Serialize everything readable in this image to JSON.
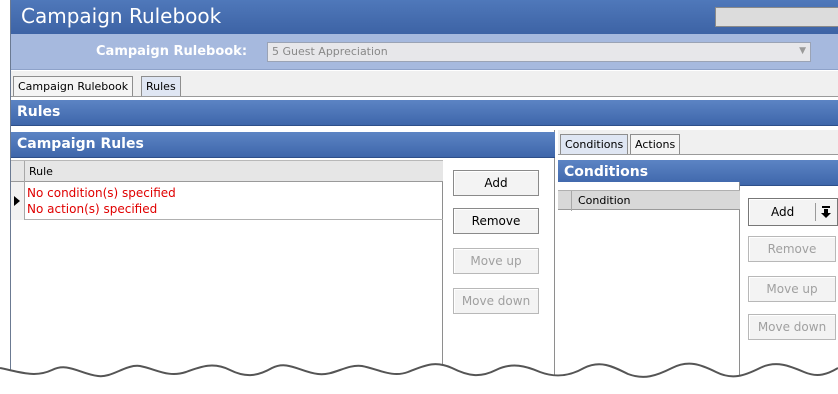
{
  "window": {
    "title": "Campaign Rulebook"
  },
  "rulebook": {
    "label": "Campaign Rulebook:",
    "selected": "5 Guest Appreciation"
  },
  "top_tabs": [
    {
      "label": "Campaign Rulebook",
      "active": false
    },
    {
      "label": "Rules",
      "active": true
    }
  ],
  "rules_section": {
    "title": "Rules"
  },
  "campaign_rules": {
    "title": "Campaign Rules",
    "column": "Rule",
    "rows": [
      {
        "line1": "No condition(s) specified",
        "line2": "No action(s) specified"
      }
    ],
    "buttons": {
      "add": "Add",
      "remove": "Remove",
      "move_up": "Move up",
      "move_down": "Move down"
    }
  },
  "right_tabs": [
    {
      "label": "Conditions",
      "active": true
    },
    {
      "label": "Actions",
      "active": false
    }
  ],
  "conditions": {
    "title": "Conditions",
    "column": "Condition",
    "buttons": {
      "add": "Add",
      "remove": "Remove",
      "move_up": "Move up",
      "move_down": "Move down"
    }
  },
  "colors": {
    "accent_blue": "#3e66aa",
    "error_red": "#e00000",
    "row_header_bg": "#a6b9de"
  },
  "icons": {
    "row_pointer": "triangle-right-icon",
    "dropdown": "arrow-down-bar-icon",
    "combo_arrow": "chevron-down-icon"
  }
}
